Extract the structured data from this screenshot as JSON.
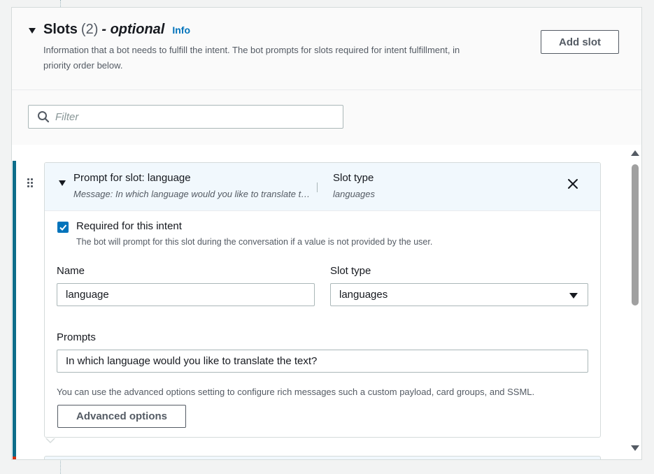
{
  "slots_section": {
    "title": "Slots",
    "count": "(2)",
    "optional_label": "- optional",
    "info_link": "Info",
    "description": "Information that a bot needs to fulfill the intent. The bot prompts for slots required for intent fulfillment, in priority order below.",
    "add_slot_button": "Add slot"
  },
  "filter": {
    "placeholder": "Filter",
    "icon": "search-icon"
  },
  "slot_card": {
    "header": {
      "title": "Prompt for slot: language",
      "message": "Message: In which language would you like to translate the text?",
      "slot_type_label": "Slot type",
      "slot_type_value": "languages",
      "close_icon": "close-icon"
    },
    "required": {
      "checked": true,
      "label": "Required for this intent",
      "description": "The bot will prompt for this slot during the conversation if a value is not provided by the user."
    },
    "name_field": {
      "label": "Name",
      "value": "language"
    },
    "slot_type_field": {
      "label": "Slot type",
      "value": "languages"
    },
    "prompts_field": {
      "label": "Prompts",
      "value": "In which language would you like to translate the text?"
    },
    "advanced": {
      "description": "You can use the advanced options setting to configure rich messages such a custom payload, card groups, and SSML.",
      "button": "Advanced options"
    }
  },
  "colors": {
    "accent": "#0d6d8a",
    "link": "#0073bb",
    "error_accent": "#d13212",
    "header_bg": "#f1f8fd"
  }
}
